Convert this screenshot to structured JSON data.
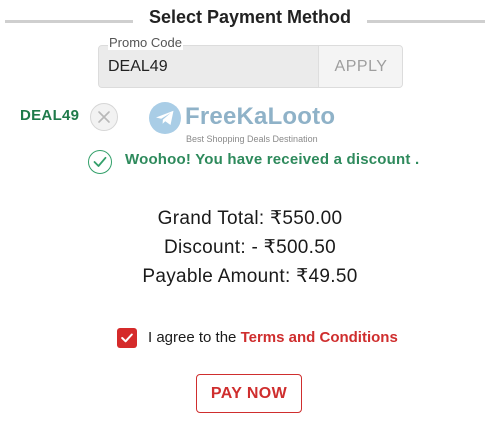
{
  "header": {
    "title": "Select Payment Method"
  },
  "promo": {
    "label": "Promo Code",
    "value": "DEAL49",
    "apply_label": "APPLY"
  },
  "applied": {
    "code": "DEAL49"
  },
  "watermark": {
    "brand": "FreeKaLooto",
    "tagline": "Best Shopping Deals Destination"
  },
  "discount_message": "Woohoo! You have received a discount .",
  "summary": {
    "grand_total": "Grand Total: ₹550.00",
    "discount": "Discount: - ₹500.50",
    "payable": "Payable Amount: ₹49.50"
  },
  "terms": {
    "checked": true,
    "prefix": "I agree to the ",
    "link": "Terms and Conditions"
  },
  "pay_button": "PAY NOW",
  "colors": {
    "accent_red": "#cf2e2e",
    "success_green": "#2e8a5c"
  }
}
